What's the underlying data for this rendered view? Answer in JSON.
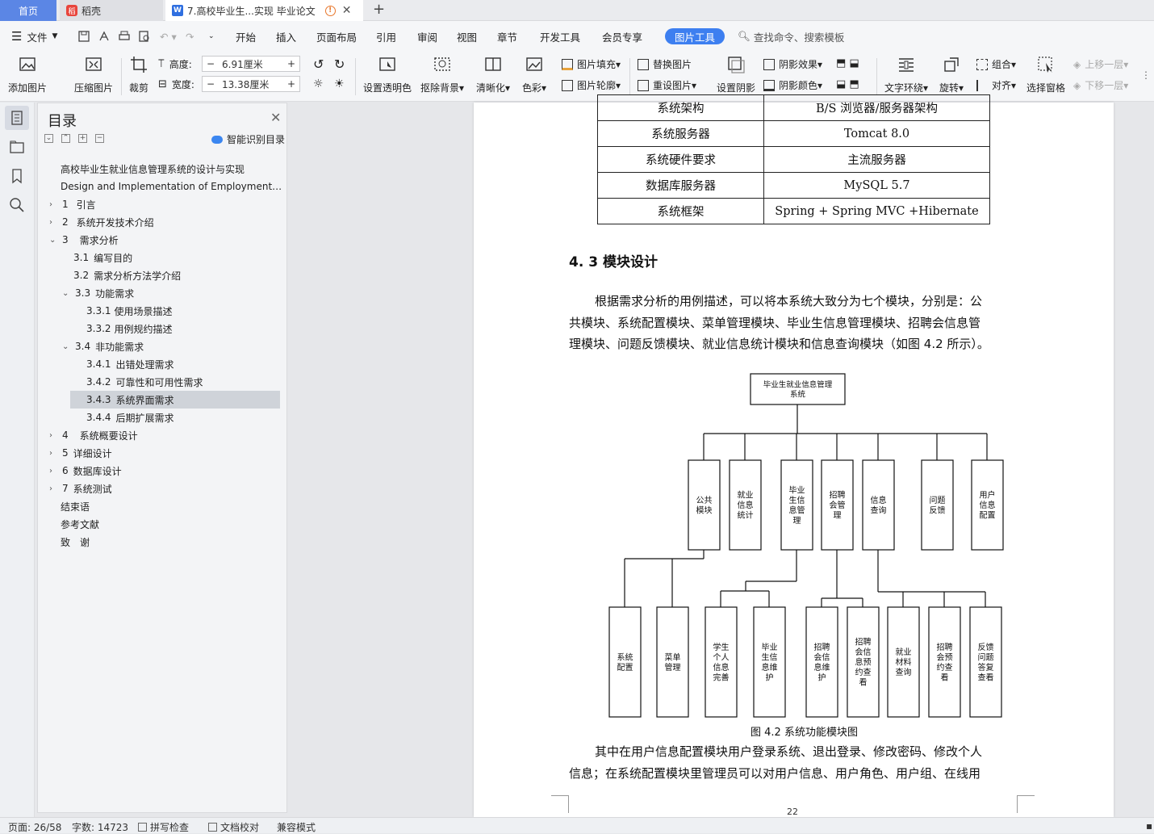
{
  "tabs": {
    "home": "首页",
    "daoke": "稻壳",
    "doc": "7.高校毕业生...实现 毕业论文"
  },
  "menu": {
    "file": "文件",
    "items": [
      "开始",
      "插入",
      "页面布局",
      "引用",
      "审阅",
      "视图",
      "章节",
      "开发工具",
      "会员专享"
    ],
    "active": "图片工具",
    "search": "查找命令、搜索模板"
  },
  "ribbon": {
    "add_image": "添加图片",
    "compress": "压缩图片",
    "crop": "裁剪",
    "height_label": "高度:",
    "height_value": "6.91厘米",
    "width_label": "宽度:",
    "width_value": "13.38厘米",
    "transparent": "设置透明色",
    "cutout": "抠除背景",
    "sharpen": "清晰化",
    "color": "色彩",
    "fill": "图片填充",
    "outline": "图片轮廓",
    "replace": "替换图片",
    "reset": "重设图片",
    "shadow": "设置阴影",
    "shadow_effect": "阴影效果",
    "shadow_color": "阴影颜色",
    "wrap": "文字环绕",
    "rotate": "旋转",
    "group": "组合",
    "align": "对齐",
    "pane": "选择窗格",
    "up": "上移一层",
    "down": "下移一层"
  },
  "toc": {
    "title": "目录",
    "smart": "智能识别目录",
    "items": [
      {
        "label": "高校毕业生就业信息管理系统的设计与实现"
      },
      {
        "label": "Design and Implementation of Employment…"
      },
      {
        "num": "1",
        "label": "引言"
      },
      {
        "num": "2",
        "label": "系统开发技术介绍"
      },
      {
        "num": "3",
        "label": "需求分析"
      },
      {
        "num": "3.1",
        "label": "编写目的"
      },
      {
        "num": "3.2",
        "label": "需求分析方法学介绍"
      },
      {
        "num": "3.3",
        "label": "功能需求"
      },
      {
        "num": "3.3.1",
        "label": "使用场景描述"
      },
      {
        "num": "3.3.2",
        "label": "用例规约描述"
      },
      {
        "num": "3.4",
        "label": "非功能需求"
      },
      {
        "num": "3.4.1",
        "label": "出错处理需求"
      },
      {
        "num": "3.4.2",
        "label": "可靠性和可用性需求"
      },
      {
        "num": "3.4.3",
        "label": "系统界面需求"
      },
      {
        "num": "3.4.4",
        "label": "后期扩展需求"
      },
      {
        "num": "4",
        "label": "系统概要设计"
      },
      {
        "num": "5",
        "label": "详细设计"
      },
      {
        "num": "6",
        "label": "数据库设计"
      },
      {
        "num": "7",
        "label": "系统测试"
      },
      {
        "label": "结束语"
      },
      {
        "label": "参考文献"
      },
      {
        "label": "致　谢"
      }
    ]
  },
  "doc": {
    "table": [
      [
        "系统架构",
        "B/S 浏览器/服务器架构"
      ],
      [
        "系统服务器",
        "Tomcat 8.0"
      ],
      [
        "系统硬件要求",
        "主流服务器"
      ],
      [
        "数据库服务器",
        "MySQL 5.7"
      ],
      [
        "系统框架",
        "Spring + Spring MVC +Hibernate"
      ]
    ],
    "heading": "4. 3  模块设计",
    "para1": [
      "根据需求分析的用例描述，可以将本系统大致分为七个模块，分别是：公",
      "共模块、系统配置模块、菜单管理模块、毕业生信息管理模块、招聘会信息管",
      "理模块、问题反馈模块、就业信息统计模块和信息查询模块（如图 4.2 所示）。"
    ],
    "diagram": {
      "root": [
        "毕业生就业信息管理",
        "系统"
      ],
      "mid": [
        [
          "公共",
          "模块"
        ],
        [
          "就业",
          "信息",
          "统计"
        ],
        [
          "毕业",
          "生信",
          "息管",
          "理"
        ],
        [
          "招聘",
          "会管",
          "理"
        ],
        [
          "信息",
          "查询"
        ],
        [
          "问题",
          "反馈"
        ],
        [
          "用户",
          "信息",
          "配置"
        ]
      ],
      "leaf": [
        [
          "系统",
          "配置"
        ],
        [
          "菜单",
          "管理"
        ],
        [
          "学生",
          "个人",
          "信息",
          "完善"
        ],
        [
          "毕业",
          "生信",
          "息维",
          "护"
        ],
        [
          "招聘",
          "会信",
          "息维",
          "护"
        ],
        [
          "招聘",
          "会信",
          "息预",
          "约查",
          "看"
        ],
        [
          "就业",
          "材料",
          "查询"
        ],
        [
          "招聘",
          "会预",
          "约查",
          "看"
        ],
        [
          "反馈",
          "问题",
          "答复",
          "查看"
        ]
      ]
    },
    "caption": "图  4.2  系统功能模块图",
    "para2": [
      "其中在用户信息配置模块用户登录系统、退出登录、修改密码、修改个人",
      "信息；在系统配置模块里管理员可以对用户信息、用户角色、用户组、在线用"
    ],
    "page_number": "22"
  },
  "status": {
    "page": "页面: 26/58",
    "words": "字数: 14723",
    "spell": "拼写检查",
    "proof": "文档校对",
    "compat": "兼容模式"
  }
}
